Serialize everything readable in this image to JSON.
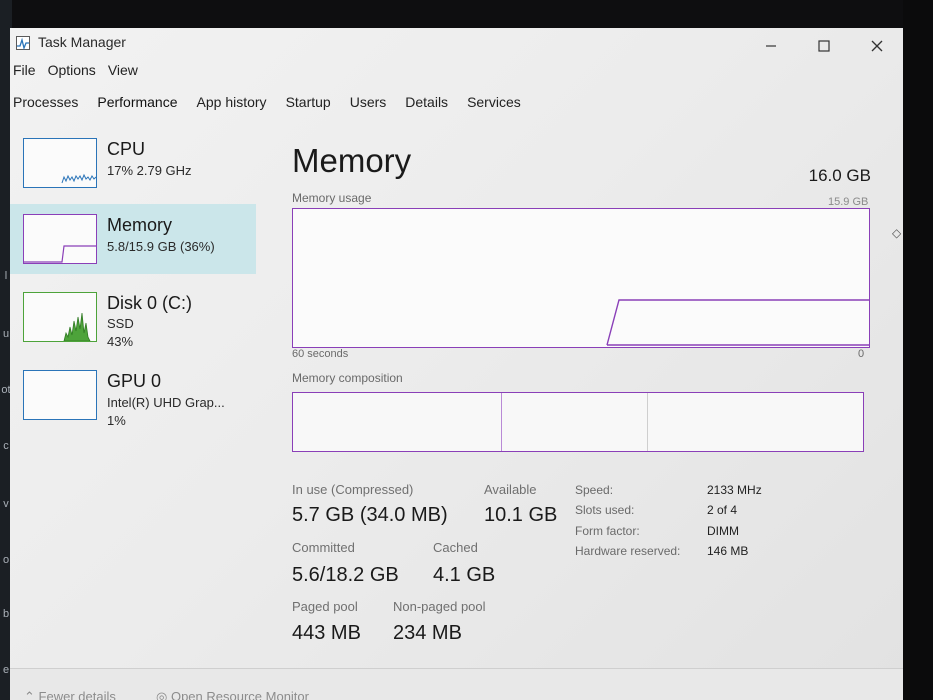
{
  "window": {
    "title": "Task Manager",
    "controls": {
      "minimize": "–",
      "maximize": "☐",
      "close": "✕"
    }
  },
  "menu": [
    "File",
    "Options",
    "View"
  ],
  "tabs": [
    "Processes",
    "Performance",
    "App history",
    "Startup",
    "Users",
    "Details",
    "Services"
  ],
  "active_tab": "Performance",
  "sidebar": {
    "items": [
      {
        "title": "CPU",
        "sub1": "17% 2.79 GHz",
        "sub2": "",
        "sub3": "",
        "color": "#2a74b8"
      },
      {
        "title": "Memory",
        "sub1": "5.8/15.9 GB (36%)",
        "sub2": "",
        "sub3": "",
        "color": "#8a3fb8"
      },
      {
        "title": "Disk 0 (C:)",
        "sub1": "SSD",
        "sub2": "43%",
        "sub3": "",
        "color": "#4da33a"
      },
      {
        "title": "GPU 0",
        "sub1": "Intel(R) UHD Grap...",
        "sub2": "1%",
        "sub3": "",
        "color": "#2a74b8"
      }
    ]
  },
  "memory": {
    "title": "Memory",
    "total": "16.0 GB",
    "usage_label": "Memory usage",
    "usage_max": "15.9 GB",
    "time_label": "60 seconds",
    "time_end": "0",
    "composition_label": "Memory composition",
    "usage_fraction": 0.36
  },
  "stats": {
    "in_use_label": "In use (Compressed)",
    "in_use_value": "5.7 GB (34.0 MB)",
    "available_label": "Available",
    "available_value": "10.1 GB",
    "committed_label": "Committed",
    "committed_value": "5.6/18.2 GB",
    "cached_label": "Cached",
    "cached_value": "4.1 GB",
    "paged_label": "Paged pool",
    "paged_value": "443 MB",
    "nonpaged_label": "Non-paged pool",
    "nonpaged_value": "234 MB"
  },
  "specs": {
    "speed_label": "Speed:",
    "speed_value": "2133 MHz",
    "slots_label": "Slots used:",
    "slots_value": "2 of 4",
    "form_label": "Form factor:",
    "form_value": "DIMM",
    "reserved_label": "Hardware reserved:",
    "reserved_value": "146 MB"
  },
  "footer": {
    "fewer_details": "Fewer details",
    "resource_monitor": "Open Resource Monitor"
  },
  "colors": {
    "memory_accent": "#8a3fb8",
    "cpu_accent": "#2a74b8",
    "disk_accent": "#4da33a",
    "selected_bg": "#cbe6ea"
  }
}
